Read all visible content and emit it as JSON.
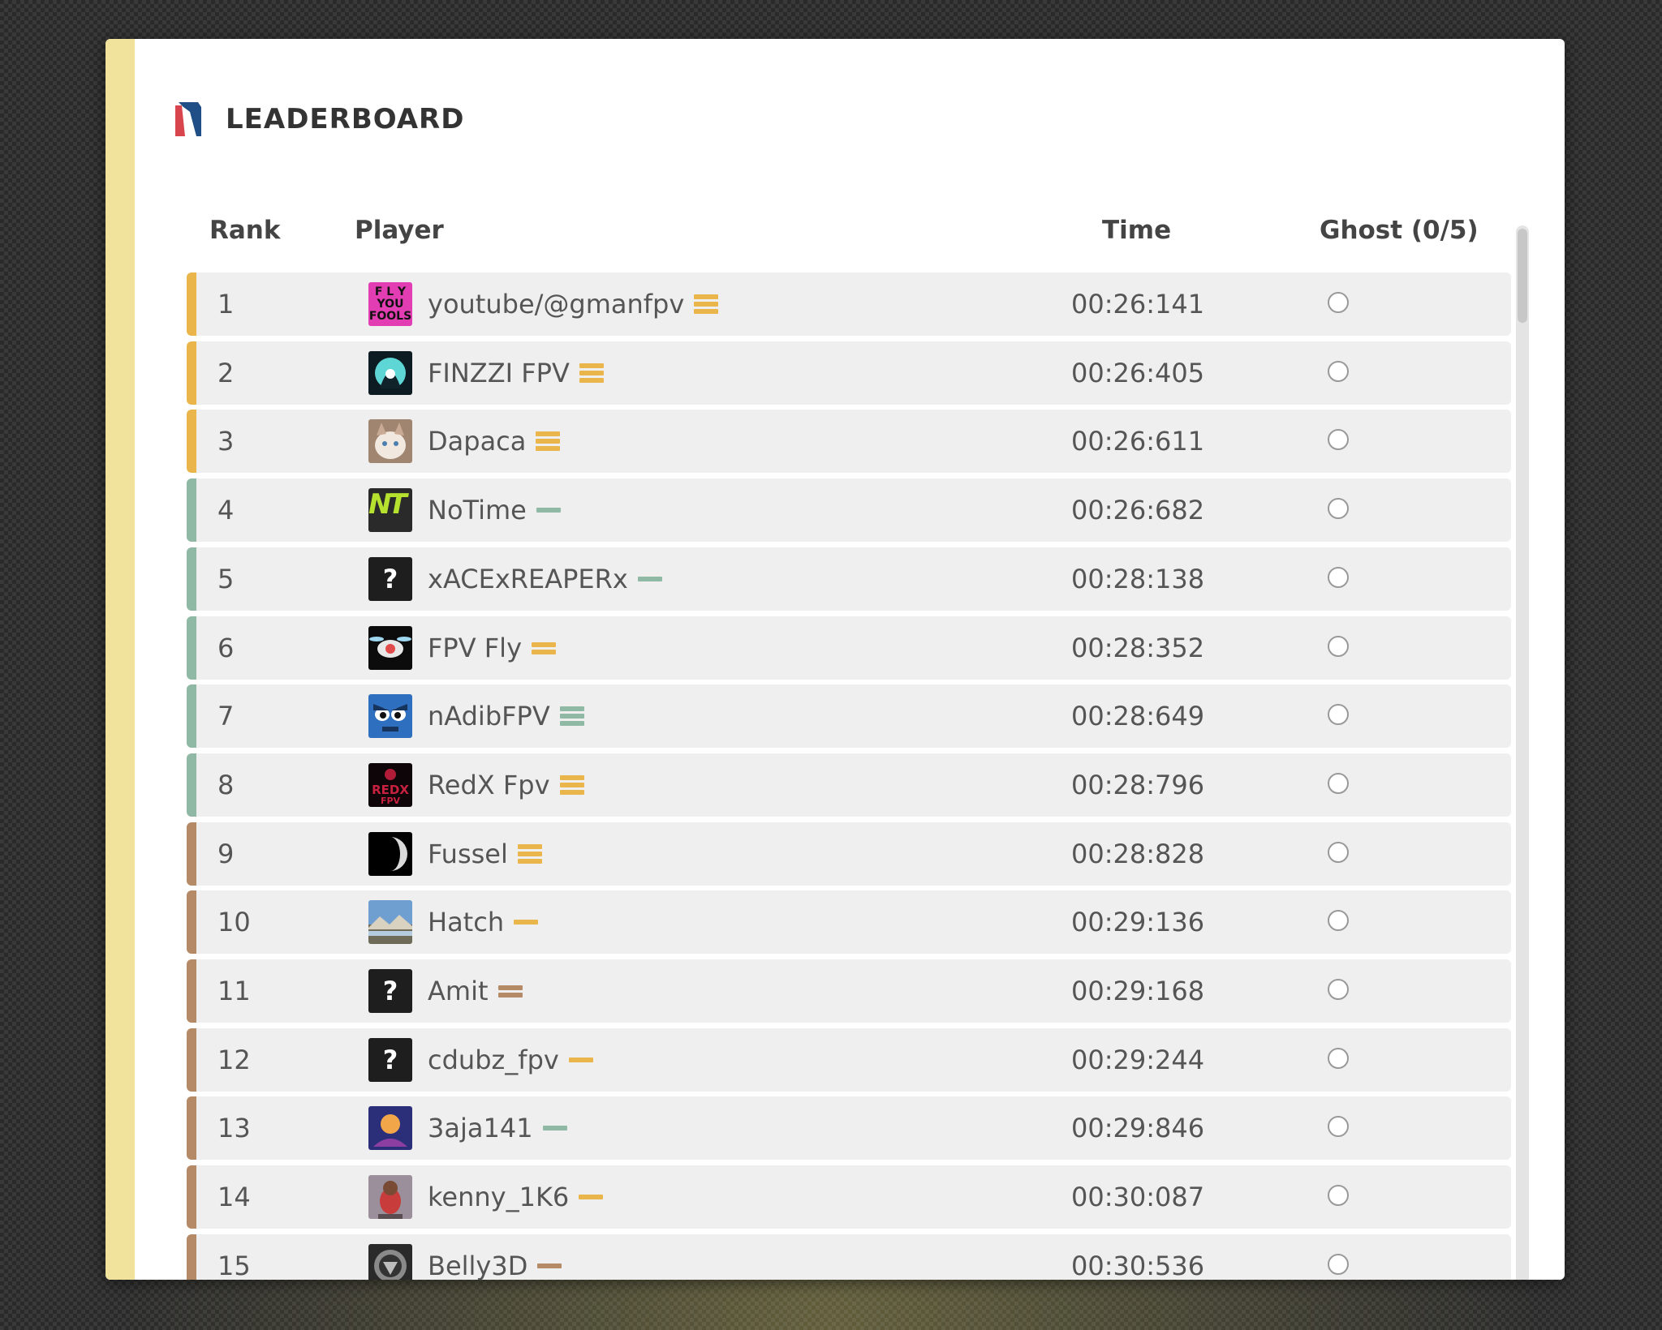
{
  "leaderboard": {
    "title": "LEADERBOARD",
    "columns": {
      "rank": "Rank",
      "player": "Player",
      "time": "Time",
      "ghost": "Ghost (0/5)"
    },
    "colors": {
      "gold": "#eab54a",
      "green": "#8fb9a4",
      "bronze": "#b58a66",
      "panel_accent": "#f1e39c"
    },
    "rows": [
      {
        "rank": "1",
        "name": "youtube/@gmanfpv",
        "time": "00:26:141",
        "tier": "gold",
        "badge": "triple",
        "badge_color": "gold",
        "avatar": "fly-you-fools-avatar"
      },
      {
        "rank": "2",
        "name": "FINZZI FPV",
        "time": "00:26:405",
        "tier": "gold",
        "badge": "triple",
        "badge_color": "gold",
        "avatar": "hooded-figure-avatar"
      },
      {
        "rank": "3",
        "name": "Dapaca",
        "time": "00:26:611",
        "tier": "gold",
        "badge": "triple",
        "badge_color": "gold",
        "avatar": "cat-avatar"
      },
      {
        "rank": "4",
        "name": "NoTime",
        "time": "00:26:682",
        "tier": "green",
        "badge": "single",
        "badge_color": "green",
        "avatar": "nt-logo-avatar"
      },
      {
        "rank": "5",
        "name": "xACExREAPERx",
        "time": "00:28:138",
        "tier": "green",
        "badge": "single",
        "badge_color": "green",
        "avatar": "unknown-avatar"
      },
      {
        "rank": "6",
        "name": "FPV Fly",
        "time": "00:28:352",
        "tier": "green",
        "badge": "double",
        "badge_color": "gold",
        "avatar": "drone-avatar"
      },
      {
        "rank": "7",
        "name": "nAdibFPV",
        "time": "00:28:649",
        "tier": "green",
        "badge": "triple",
        "badge_color": "green",
        "avatar": "angry-face-avatar"
      },
      {
        "rank": "8",
        "name": "RedX Fpv",
        "time": "00:28:796",
        "tier": "green",
        "badge": "triple",
        "badge_color": "gold",
        "avatar": "redx-logo-avatar"
      },
      {
        "rank": "9",
        "name": "Fussel",
        "time": "00:28:828",
        "tier": "bronze",
        "badge": "triple",
        "badge_color": "gold",
        "avatar": "moon-avatar"
      },
      {
        "rank": "10",
        "name": "Hatch",
        "time": "00:29:136",
        "tier": "bronze",
        "badge": "single",
        "badge_color": "gold",
        "avatar": "landscape-avatar"
      },
      {
        "rank": "11",
        "name": "Amit",
        "time": "00:29:168",
        "tier": "bronze",
        "badge": "double",
        "badge_color": "bronze",
        "avatar": "unknown-avatar"
      },
      {
        "rank": "12",
        "name": "cdubz_fpv",
        "time": "00:29:244",
        "tier": "bronze",
        "badge": "single",
        "badge_color": "gold",
        "avatar": "unknown-avatar"
      },
      {
        "rank": "13",
        "name": "3aja141",
        "time": "00:29:846",
        "tier": "bronze",
        "badge": "single",
        "badge_color": "green",
        "avatar": "planet-avatar"
      },
      {
        "rank": "14",
        "name": "kenny_1K6",
        "time": "00:30:087",
        "tier": "bronze",
        "badge": "single",
        "badge_color": "gold",
        "avatar": "character-avatar"
      },
      {
        "rank": "15",
        "name": "Belly3D",
        "time": "00:30:536",
        "tier": "bronze",
        "badge": "single",
        "badge_color": "bronze",
        "avatar": "emblem-avatar"
      }
    ]
  }
}
